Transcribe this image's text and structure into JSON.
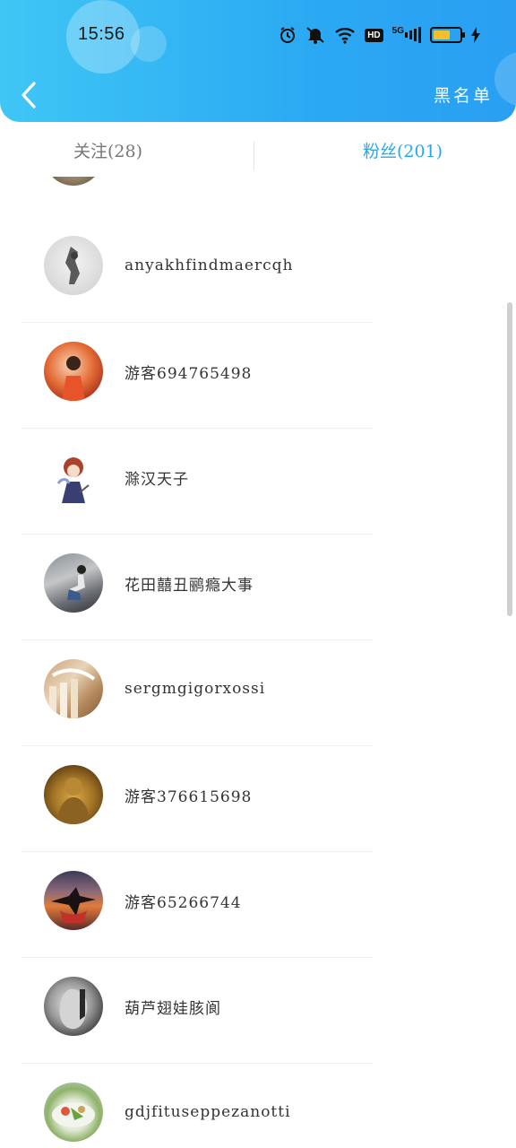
{
  "status_bar": {
    "time": "15:56",
    "icons": [
      "alarm-icon",
      "mute-icon",
      "wifi-icon",
      "hd-icon",
      "5g-signal-icon",
      "battery-icon",
      "charging-icon"
    ],
    "hd_label": "HD",
    "network_label": "5G"
  },
  "nav": {
    "back_icon": "chevron-left-icon",
    "blacklist_label": "黑名单"
  },
  "tabs": {
    "follow_label": "关注(28)",
    "fans_label": "粉丝(201)",
    "active": "fans"
  },
  "fans": [
    {
      "name": "anyakhfindmaercqh"
    },
    {
      "name": "游客694765498"
    },
    {
      "name": "滁汉天子"
    },
    {
      "name": "花田囍丑鹂瘾大事"
    },
    {
      "name": "sergmgigorxossi"
    },
    {
      "name": "游客376615698"
    },
    {
      "name": "游客65266744"
    },
    {
      "name": "葫芦翅娃胲阆"
    },
    {
      "name": "gdjfituseppezanotti"
    }
  ],
  "colors": {
    "header_start": "#3fc6f5",
    "header_end": "#2a9ff2",
    "active_tab": "#27a8ea",
    "inactive_tab": "#777777"
  }
}
